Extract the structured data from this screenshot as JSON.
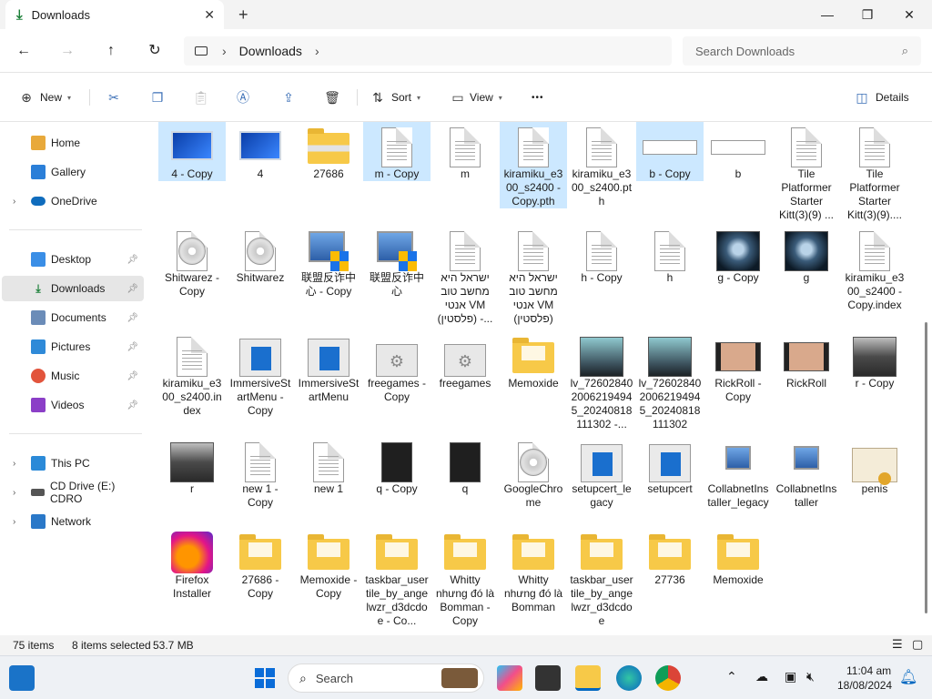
{
  "window": {
    "tab_title": "Downloads",
    "tab_close": "✕",
    "new_tab": "+",
    "minimize": "—",
    "maximize": "❐",
    "close": "✕"
  },
  "address": {
    "breadcrumb": "Downloads",
    "search_placeholder": "Search Downloads"
  },
  "toolbar": {
    "new_label": "New",
    "sort_label": "Sort",
    "view_label": "View",
    "more_label": "•••",
    "details_label": "Details"
  },
  "sidebar": {
    "home": "Home",
    "gallery": "Gallery",
    "onedrive": "OneDrive",
    "desktop": "Desktop",
    "downloads": "Downloads",
    "documents": "Documents",
    "pictures": "Pictures",
    "music": "Music",
    "videos": "Videos",
    "thispc": "This PC",
    "cddrive": "CD Drive (E:) CDRO",
    "network": "Network"
  },
  "files": [
    {
      "name": "4 - Copy",
      "icon": "win11-wallpaper",
      "selected": true
    },
    {
      "name": "4",
      "icon": "win11-wallpaper",
      "selected": false
    },
    {
      "name": "27686",
      "icon": "folder-zip",
      "selected": false
    },
    {
      "name": "m - Copy",
      "icon": "doc",
      "selected": true
    },
    {
      "name": "m",
      "icon": "doc",
      "selected": false
    },
    {
      "name": "kiramiku_e300_s2400 - Copy.pth",
      "icon": "doc",
      "selected": true
    },
    {
      "name": "kiramiku_e300_s2400.pth",
      "icon": "doc",
      "selected": false
    },
    {
      "name": "b - Copy",
      "icon": "wide",
      "selected": true
    },
    {
      "name": "b",
      "icon": "wide",
      "selected": false
    },
    {
      "name": "Tile Platformer Starter Kitt(3)(9) ...",
      "icon": "doc",
      "selected": false
    },
    {
      "name": "Tile Platformer Starter Kitt(3)(9)....",
      "icon": "doc",
      "selected": false
    },
    {
      "name": "Shitwarez - Copy",
      "icon": "disc-doc",
      "selected": false
    },
    {
      "name": "Shitwarez",
      "icon": "disc-doc",
      "selected": false
    },
    {
      "name": "联盟反诈中心 - Copy",
      "icon": "shield-monitor",
      "selected": false
    },
    {
      "name": "联盟反诈中心",
      "icon": "shield-monitor",
      "selected": false
    },
    {
      "name": "ישראל היא מחשב טוב אנטי VM (פלסטין) -...",
      "icon": "doc",
      "selected": false
    },
    {
      "name": "ישראל היא מחשב טוב אנטי VM (פלסטין)",
      "icon": "doc",
      "selected": false
    },
    {
      "name": "h - Copy",
      "icon": "doc",
      "selected": false
    },
    {
      "name": "h",
      "icon": "doc",
      "selected": false
    },
    {
      "name": "g - Copy",
      "icon": "photo-robot",
      "selected": false
    },
    {
      "name": "g",
      "icon": "photo-robot",
      "selected": false
    },
    {
      "name": "kiramiku_e300_s2400 - Copy.index",
      "icon": "doc",
      "selected": false
    },
    {
      "name": "kiramiku_e300_s2400.index",
      "icon": "doc",
      "selected": false
    },
    {
      "name": "ImmersiveStartMenu - Copy",
      "icon": "app",
      "selected": false
    },
    {
      "name": "ImmersiveStartMenu",
      "icon": "app",
      "selected": false
    },
    {
      "name": "freegames - Copy",
      "icon": "gear",
      "selected": false
    },
    {
      "name": "freegames",
      "icon": "gear",
      "selected": false
    },
    {
      "name": "Memoxide",
      "icon": "folder",
      "selected": false
    },
    {
      "name": "lv_7260284020062194945_20240818111302 -...",
      "icon": "photo-anime",
      "selected": false
    },
    {
      "name": "lv_7260284020062194945_20240818111302",
      "icon": "photo-anime",
      "selected": false
    },
    {
      "name": "RickRoll - Copy",
      "icon": "video",
      "selected": false
    },
    {
      "name": "RickRoll",
      "icon": "video",
      "selected": false
    },
    {
      "name": "r - Copy",
      "icon": "photo-desk",
      "selected": false
    },
    {
      "name": "r",
      "icon": "photo-desk",
      "selected": false
    },
    {
      "name": "new 1 - Copy",
      "icon": "doc",
      "selected": false
    },
    {
      "name": "new 1",
      "icon": "doc",
      "selected": false
    },
    {
      "name": "q - Copy",
      "icon": "photo-dark",
      "selected": false
    },
    {
      "name": "q",
      "icon": "photo-dark",
      "selected": false
    },
    {
      "name": "GoogleChrome",
      "icon": "disc-doc",
      "selected": false
    },
    {
      "name": "setupcert_legacy",
      "icon": "app",
      "selected": false
    },
    {
      "name": "setupcert",
      "icon": "app",
      "selected": false
    },
    {
      "name": "CollabnetInstaller_legacy",
      "icon": "installer",
      "selected": false
    },
    {
      "name": "CollabnetInstaller",
      "icon": "installer",
      "selected": false
    },
    {
      "name": "penis",
      "icon": "cert",
      "selected": false
    },
    {
      "name": "Firefox Installer",
      "icon": "firefox",
      "selected": false
    },
    {
      "name": "27686 - Copy",
      "icon": "folder",
      "selected": false
    },
    {
      "name": "Memoxide - Copy",
      "icon": "folder",
      "selected": false
    },
    {
      "name": "taskbar_usertile_by_angelwzr_d3dcdoe - Co...",
      "icon": "folder",
      "selected": false
    },
    {
      "name": "Whitty nhưng đó là Bomman - Copy",
      "icon": "folder",
      "selected": false
    },
    {
      "name": "Whitty nhưng đó là Bomman",
      "icon": "folder",
      "selected": false
    },
    {
      "name": "taskbar_usertile_by_angelwzr_d3dcdoe",
      "icon": "folder",
      "selected": false
    },
    {
      "name": "27736",
      "icon": "folder",
      "selected": false
    },
    {
      "name": "Memoxide",
      "icon": "folder",
      "selected": false
    }
  ],
  "status": {
    "items": "75 items",
    "selected": "8 items selected",
    "size": "53.7 MB"
  },
  "taskbar": {
    "search_label": "Search",
    "time": "11:04 am",
    "date": "18/08/2024"
  },
  "colors": {
    "accent": "#0067c0",
    "selection": "#cce8ff",
    "folder": "#f7c948"
  }
}
